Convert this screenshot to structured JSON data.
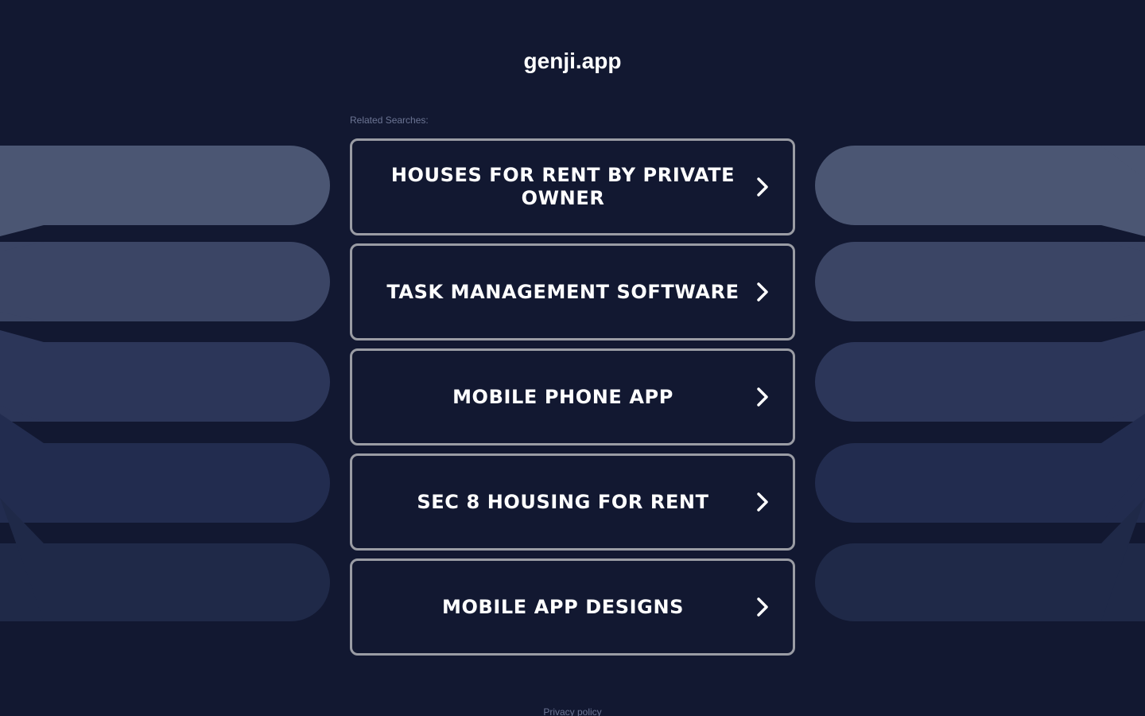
{
  "site": {
    "title": "genji.app"
  },
  "related": {
    "label": "Related Searches:"
  },
  "links": [
    {
      "text": "HOUSES FOR RENT BY PRIVATE OWNER"
    },
    {
      "text": "TASK MANAGEMENT SOFTWARE"
    },
    {
      "text": "MOBILE PHONE APP"
    },
    {
      "text": "SEC 8 HOUSING FOR RENT"
    },
    {
      "text": "MOBILE APP DESIGNS"
    }
  ],
  "footer": {
    "privacy": "Privacy policy"
  },
  "icons": {
    "link_chevron": "chevron-right-icon"
  },
  "colors": {
    "background": "#121831",
    "band1": "#4b5673",
    "band2": "#3b4565",
    "band3": "#2c3659",
    "band4": "#222c4f",
    "band5": "#1f2948",
    "box_border": "#9a9ca4",
    "text": "#ffffff",
    "muted_text": "#6c7594"
  }
}
